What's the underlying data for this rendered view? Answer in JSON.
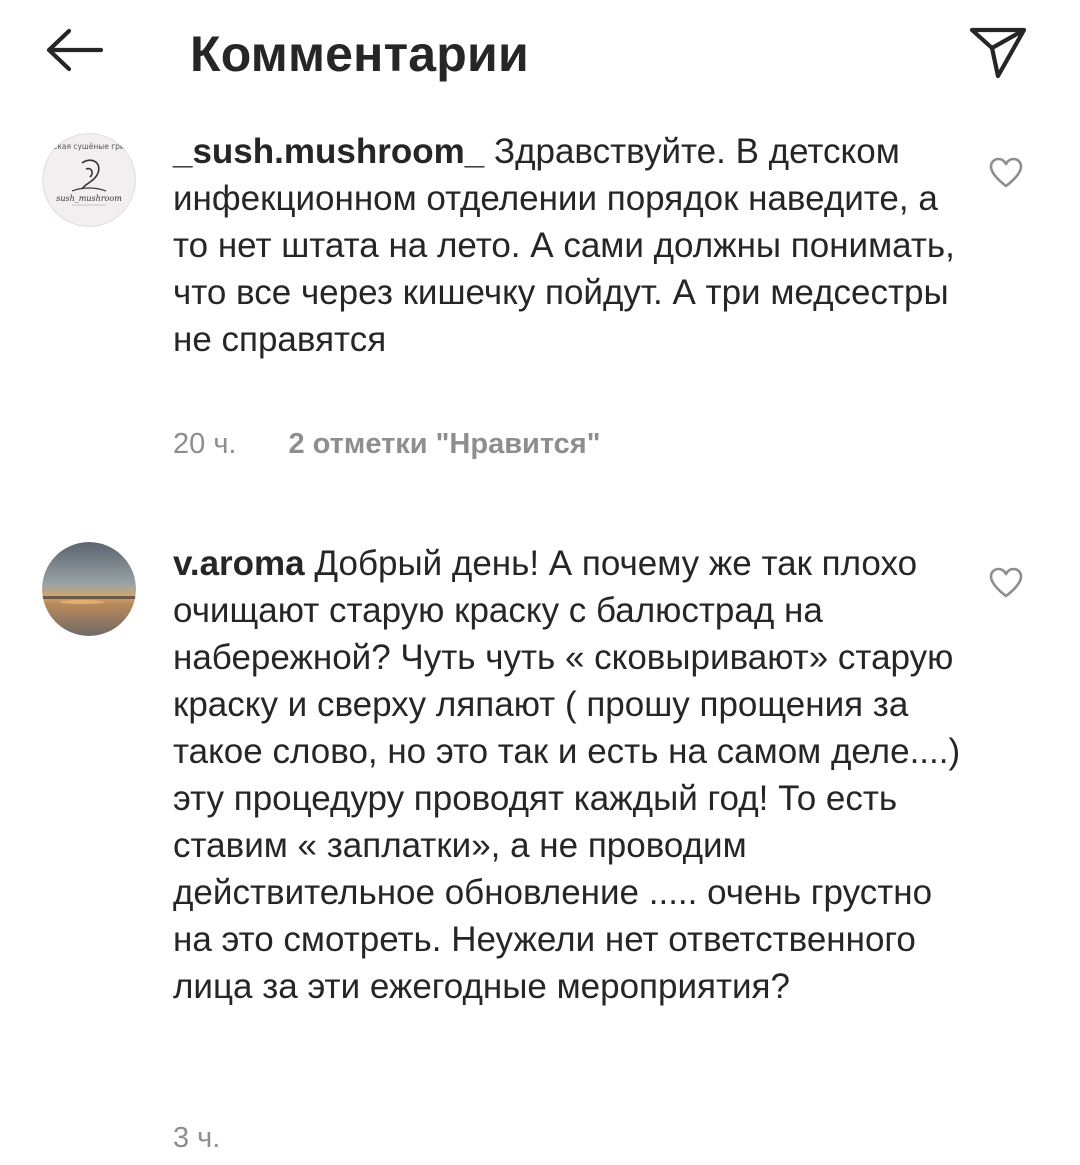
{
  "header": {
    "title": "Комментарии",
    "back_icon": "arrow-left-icon",
    "send_icon": "paper-plane-icon"
  },
  "comments": [
    {
      "username": "_sush.mushroom_",
      "text": "Здравствуйте. В детском инфекционном отделении порядок наведите, а то нет штата на лето. А сами должны понимать, что все через кишечку пойдут. А три медсестры не справятся",
      "time": "20 ч.",
      "likes": "2 отметки \"Нравится\"",
      "avatar_lines": [
        "ская сушёные гри",
        "sush_mushroom"
      ],
      "like_icon": "heart-icon"
    },
    {
      "username": "v.aroma",
      "text": "Добрый день! А почему же так плохо очищают старую краску с балюстрад на набережной? Чуть чуть « сковыривают» старую краску и сверху ляпают ( прошу прощения за такое слово, но это так и есть на самом деле....) эту процедуру проводят каждый год! То есть ставим « заплатки», а не проводим действительное обновление ..... очень грустно на это смотреть. Неужели нет ответственного лица за эти ежегодные мероприятия?",
      "time": "3 ч.",
      "like_icon": "heart-icon"
    }
  ],
  "colors": {
    "text": "#262626",
    "secondary": "#8e8e8e",
    "background": "#ffffff"
  }
}
